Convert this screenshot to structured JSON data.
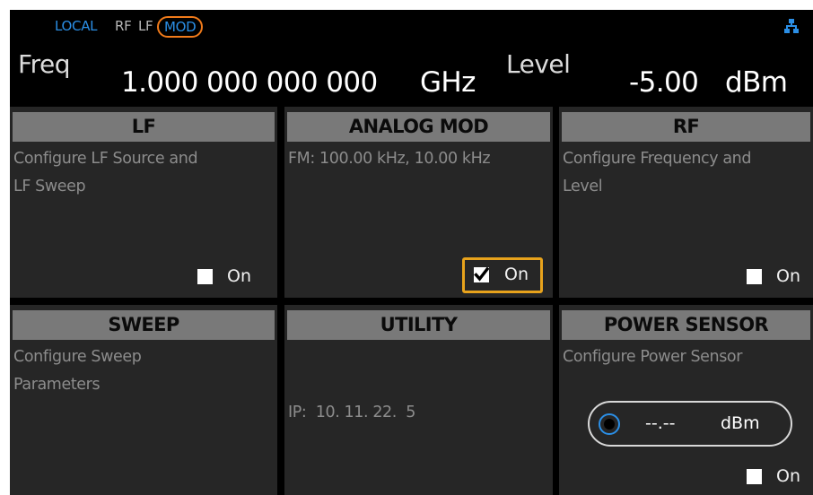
{
  "status_bar": {
    "local": "LOCAL",
    "rf": "RF",
    "lf": "LF",
    "mod": "MOD",
    "network_icon": "network-icon"
  },
  "readout": {
    "freq_label": "Freq",
    "freq_value": "1.000 000 000 000",
    "freq_unit": "GHz",
    "level_label": "Level",
    "level_value": "-5.00",
    "level_unit": "dBm"
  },
  "tiles": {
    "lf": {
      "title": "LF",
      "desc1": "Configure LF Source and",
      "desc2": "LF Sweep",
      "toggle_label": "On",
      "checked": false
    },
    "analog_mod": {
      "title": "ANALOG MOD",
      "desc1": "FM: 100.00 kHz, 10.00 kHz",
      "toggle_label": "On",
      "checked": true
    },
    "rf": {
      "title": "RF",
      "desc1": "Configure Frequency and",
      "desc2": "Level",
      "toggle_label": "On",
      "checked": false
    },
    "sweep": {
      "title": "SWEEP",
      "desc1": "Configure Sweep",
      "desc2": "Parameters"
    },
    "utility": {
      "title": "UTILITY",
      "desc1": "IP:  10. 11. 22.  5"
    },
    "power_sensor": {
      "title": "POWER SENSOR",
      "desc1": "Configure Power Sensor",
      "reading_value": "--.--",
      "reading_unit": "dBm",
      "toggle_label": "On",
      "checked": false
    }
  },
  "colors": {
    "background": "#000000",
    "tile": "#262626",
    "tile_header": "#797979",
    "accent_blue": "#2b8fe6",
    "focus_orange": "#e8a31c",
    "mod_ring": "#f07a1a"
  }
}
